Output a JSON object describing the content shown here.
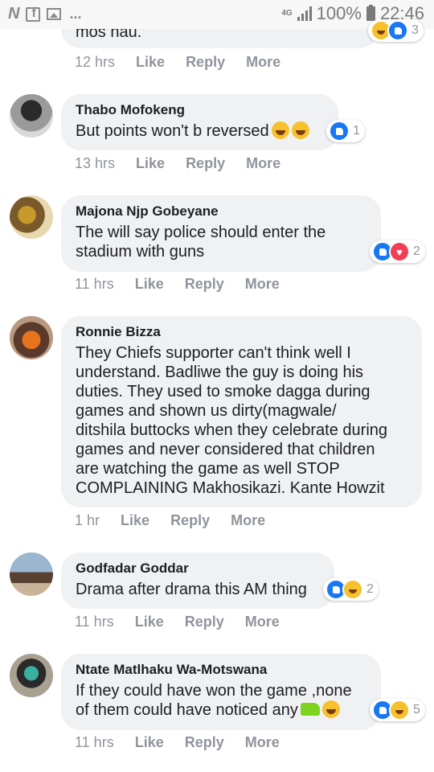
{
  "status_bar": {
    "network": "4G",
    "battery": "100%",
    "time": "22:46"
  },
  "comments": [
    {
      "author": "",
      "text": "mos hau.",
      "reactions_count": "3",
      "time": "12 hrs",
      "actions": [
        "Like",
        "Reply",
        "More"
      ]
    },
    {
      "author": "Thabo Mofokeng",
      "text": "But points won't b reversed",
      "reactions_count": "1",
      "time": "13 hrs",
      "actions": [
        "Like",
        "Reply",
        "More"
      ]
    },
    {
      "author": "Majona Njp Gobeyane",
      "text": "The will say police should enter the\nstadium with guns",
      "reactions_count": "2",
      "time": "11 hrs",
      "actions": [
        "Like",
        "Reply",
        "More"
      ]
    },
    {
      "author": "Ronnie Bizza",
      "text": "They Chiefs supporter can't think well I\nunderstand. Badliwe the guy is doing his\nduties. They used to smoke dagga during\ngames and shown us dirty(magwale/\nditshila buttocks when they celebrate during\ngames and never considered that children\nare watching the game as well STOP\nCOMPLAINING Makhosikazi. Kante Howzit",
      "reactions_count": "",
      "time": "1 hr",
      "actions": [
        "Like",
        "Reply",
        "More"
      ]
    },
    {
      "author": "Godfadar Goddar",
      "text": "Drama after drama this AM thing",
      "reactions_count": "2",
      "time": "11 hrs",
      "actions": [
        "Like",
        "Reply",
        "More"
      ]
    },
    {
      "author": "Ntate Matlhaku Wa-Motswana",
      "text": "If they could have won the game ,none\nof them could have noticed any",
      "reactions_count": "5",
      "time": "11 hrs",
      "actions": [
        "Like",
        "Reply",
        "More"
      ]
    }
  ],
  "colors": {
    "bubble": "#f0f1f3",
    "meta": "#90949c",
    "like_blue": "#1877f2",
    "love_red": "#f33e58",
    "haha_yellow": "#f7c12e"
  }
}
